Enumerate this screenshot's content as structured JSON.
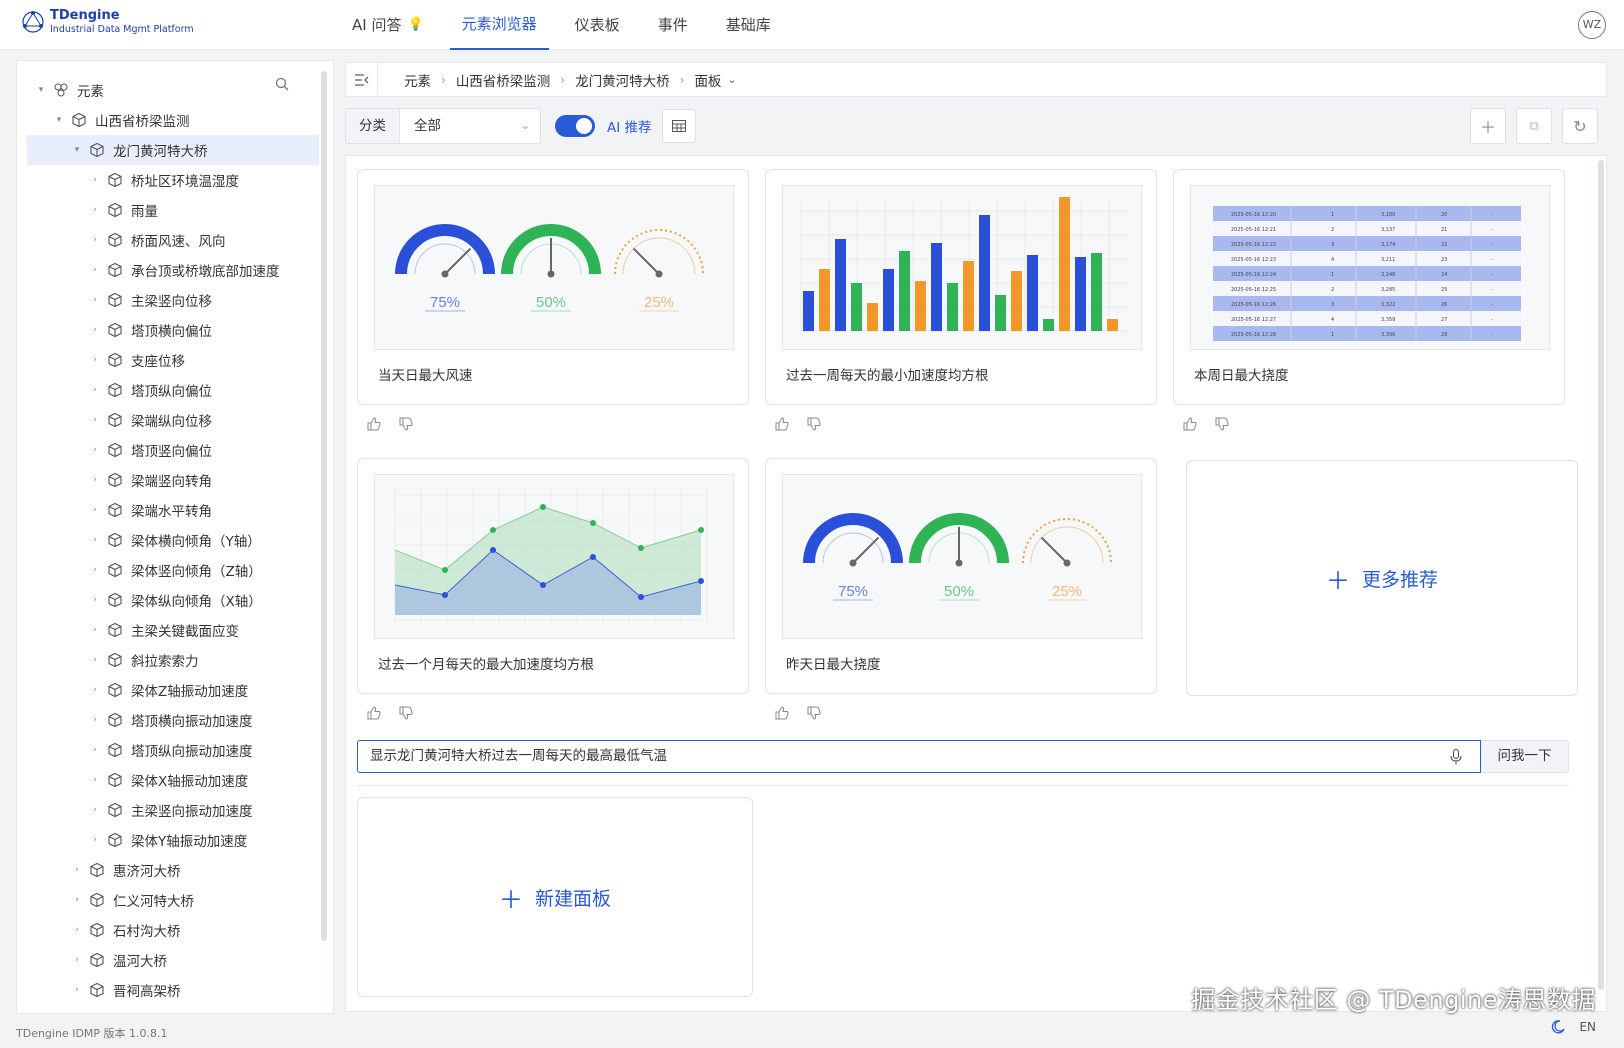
{
  "app": {
    "logo_title": "TDengine",
    "logo_subtitle": "Industrial Data Mgmt Platform",
    "avatar_initials": "WZ",
    "version": "TDengine IDMP 版本 1.0.8.1",
    "lang": "EN",
    "watermark": "掘金技术社区 @ TDengine涛思数据"
  },
  "nav": [
    {
      "label": "AI 问答",
      "active": false
    },
    {
      "label": "元素浏览器",
      "active": true
    },
    {
      "label": "仪表板",
      "active": false
    },
    {
      "label": "事件",
      "active": false
    },
    {
      "label": "基础库",
      "active": false
    }
  ],
  "tree": {
    "root": "元素",
    "group": "山西省桥梁监测",
    "selected": "龙门黄河特大桥",
    "children": [
      "桥址区环境温湿度",
      "雨量",
      "桥面风速、风向",
      "承台顶或桥墩底部加速度",
      "主梁竖向位移",
      "塔顶横向偏位",
      "支座位移",
      "塔顶纵向偏位",
      "梁端纵向位移",
      "塔顶竖向偏位",
      "梁端竖向转角",
      "梁端水平转角",
      "梁体横向倾角（Y轴）",
      "梁体竖向倾角（Z轴）",
      "梁体纵向倾角（X轴）",
      "主梁关键截面应变",
      "斜拉索索力",
      "梁体Z轴振动加速度",
      "塔顶横向振动加速度",
      "塔顶纵向振动加速度",
      "梁体X轴振动加速度",
      "主梁竖向振动加速度",
      "梁体Y轴振动加速度"
    ],
    "siblings": [
      "惠济河大桥",
      "仁义河特大桥",
      "石村沟大桥",
      "温河大桥",
      "晋祠高架桥"
    ]
  },
  "breadcrumb": [
    "元素",
    "山西省桥梁监测",
    "龙门黄河特大桥",
    "面板"
  ],
  "toolbar": {
    "category_label": "分类",
    "category_value": "全部",
    "ai_toggle_on": true,
    "ai_label": "AI 推荐"
  },
  "cards": [
    {
      "title": "当天日最大风速",
      "type": "gauge"
    },
    {
      "title": "过去一周每天的最小加速度均方根",
      "type": "bar"
    },
    {
      "title": "本周日最大挠度",
      "type": "table"
    },
    {
      "title": "过去一个月每天的最大加速度均方根",
      "type": "area"
    },
    {
      "title": "昨天日最大挠度",
      "type": "gauge"
    }
  ],
  "more_label": "更多推荐",
  "gauges": [
    {
      "value": 0.75,
      "label": "75%",
      "color": "#2a4fd8"
    },
    {
      "value": 0.5,
      "label": "50%",
      "color": "#2fb455"
    },
    {
      "value": 0.25,
      "label": "25%",
      "color": "#f0a040"
    }
  ],
  "ask": {
    "query": "显示龙门黄河特大桥过去一周每天的最高最低气温",
    "button": "问我一下"
  },
  "new_panel_label": "新建面板",
  "colors": {
    "accent": "#2a5bd7",
    "blue": "#2a4fd8",
    "orange": "#f5962a",
    "green": "#2fb455"
  }
}
